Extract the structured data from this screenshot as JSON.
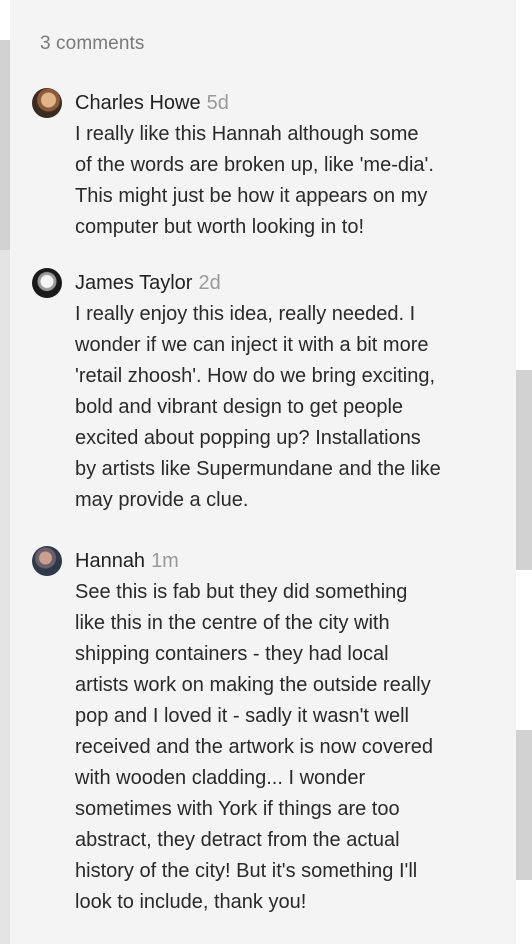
{
  "comments_header": {
    "count_label": "3 comments"
  },
  "comments": [
    {
      "author": "Charles Howe",
      "time": "5d",
      "lines": [
        "I really like this Hannah although some",
        "of the words are broken up, like 'me-dia'.",
        "This might just be how it appears on my",
        "computer but worth looking in to!"
      ]
    },
    {
      "author": "James Taylor",
      "time": "2d",
      "lines": [
        "I really enjoy this idea, really needed. I",
        "wonder if we can inject it with a bit more",
        "'retail zhoosh'. How do we bring exciting,",
        "bold and vibrant design to get people",
        "excited about popping up? Installations",
        "by artists like Supermundane and the like",
        "may provide a clue."
      ]
    },
    {
      "author": "Hannah",
      "time": "1m",
      "lines": [
        "See this is fab but they did something",
        "like this in the centre of the city with",
        "shipping containers - they had local",
        "artists work on making the outside really",
        "pop and I loved it - sadly it wasn't well",
        "received and the artwork is now covered",
        "with wooden cladding... I wonder",
        "sometimes with York if things are too",
        "abstract, they detract from the actual",
        "history of the city! But it's something I'll",
        "look to include, thank you!"
      ]
    }
  ]
}
